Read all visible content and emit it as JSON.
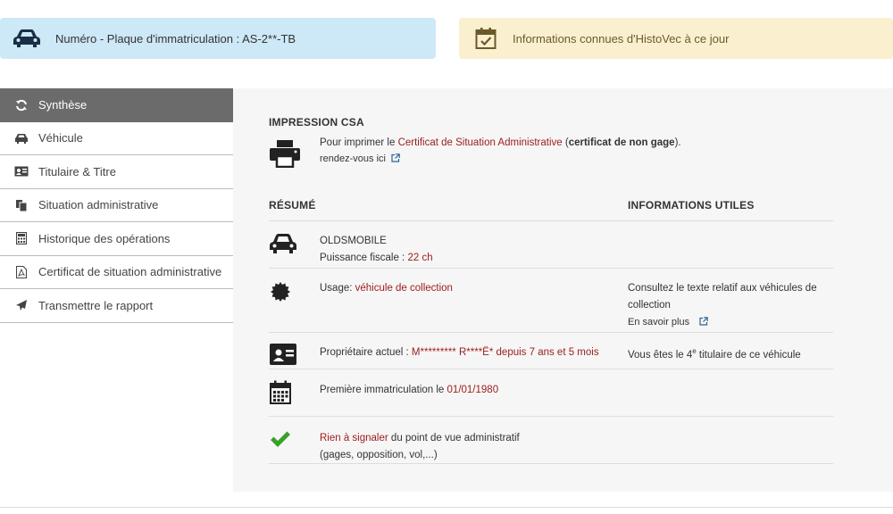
{
  "banner": {
    "plate_text": "Numéro - Plaque d'immatriculation : AS-2**-TB",
    "info_text": "Informations connues d'HistoVec à ce jour"
  },
  "sidebar": {
    "items": [
      {
        "label": "Synthèse",
        "icon": "refresh-icon"
      },
      {
        "label": "Véhicule",
        "icon": "car-icon"
      },
      {
        "label": "Titulaire & Titre",
        "icon": "id-card-icon"
      },
      {
        "label": "Situation administrative",
        "icon": "documents-icon"
      },
      {
        "label": "Historique des opérations",
        "icon": "calculator-icon"
      },
      {
        "label": "Certificat de situation administrative",
        "icon": "pdf-icon"
      },
      {
        "label": "Transmettre le rapport",
        "icon": "paper-plane-icon"
      }
    ]
  },
  "csa": {
    "heading": "IMPRESSION CSA",
    "text_prefix": "Pour imprimer le",
    "link_certificate": "Certificat de Situation Administrative",
    "paren_open": "(",
    "bold_text": "certificat de non gage",
    "paren_close": ").",
    "visit_link": "rendez-vous ici"
  },
  "resume": {
    "heading": "RÉSUMÉ",
    "info_heading": "INFORMATIONS UTILES",
    "brand": "OLDSMOBILE",
    "power_label": "Puissance fiscale :",
    "power_value": "22 ch",
    "usage_label": "Usage:",
    "usage_value": "véhicule de collection",
    "usage_info_line1": "Consultez le texte relatif aux véhicules de",
    "usage_info_line2": "collection",
    "learn_more": "En savoir plus",
    "owner_label": "Propriétaire actuel :",
    "owner_value": "M********* R****Ë* depuis 7 ans et 5 mois",
    "owner_info_prefix": "Vous êtes le 4",
    "owner_info_sup": "e",
    "owner_info_suffix": "titulaire de ce véhicule",
    "first_reg_label": "Première immatriculation le",
    "first_reg_value": "01/01/1980",
    "nothing_link": "Rien à signaler",
    "nothing_text": "du point de vue administratif",
    "nothing_sub": "(gages, opposition, vol,...)"
  },
  "colors": {
    "plate_banner": "#cde8f6",
    "info_banner": "#faf0cf",
    "active_sidebar": "#6b6b6b",
    "accent_red": "#9b1c1c",
    "link_blue": "#2a6496",
    "check_green": "#3aa02a"
  }
}
